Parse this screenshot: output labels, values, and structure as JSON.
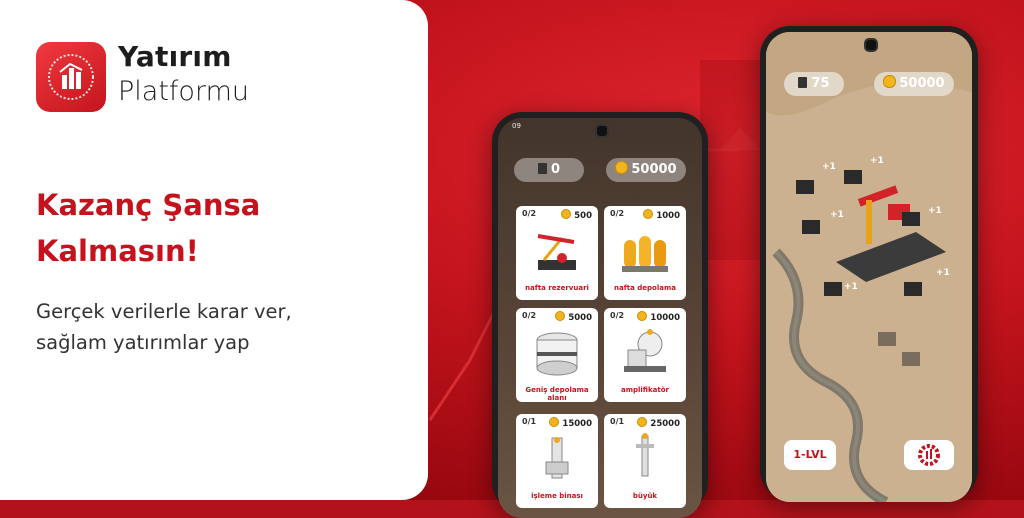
{
  "brand": {
    "line1": "Yatırım",
    "line2": "Platformu"
  },
  "headline": {
    "line1": "Kazanç Şansa",
    "line2": "Kalmasın!"
  },
  "subtitle": {
    "line1": "Gerçek verilerle karar ver,",
    "line2": "sağlam yatırımlar yap"
  },
  "phone_left": {
    "status_time": "09",
    "counter": "0",
    "coins": "50000",
    "cards": [
      {
        "count": "0/2",
        "price": "500",
        "name": "nafta rezervuari"
      },
      {
        "count": "0/2",
        "price": "1000",
        "name": "nafta depolama"
      },
      {
        "count": "0/2",
        "price": "5000",
        "name": "Geniş depolama alanı"
      },
      {
        "count": "0/2",
        "price": "10000",
        "name": "amplifikatör"
      },
      {
        "count": "0/1",
        "price": "15000",
        "name": "işleme binası"
      },
      {
        "count": "0/1",
        "price": "25000",
        "name": "büyük"
      }
    ]
  },
  "phone_right": {
    "counter": "75",
    "coins": "50000",
    "plus_label": "+1",
    "level": "1-LVL"
  },
  "colors": {
    "brand_red": "#c6121d",
    "background_red": "#b3121b"
  }
}
